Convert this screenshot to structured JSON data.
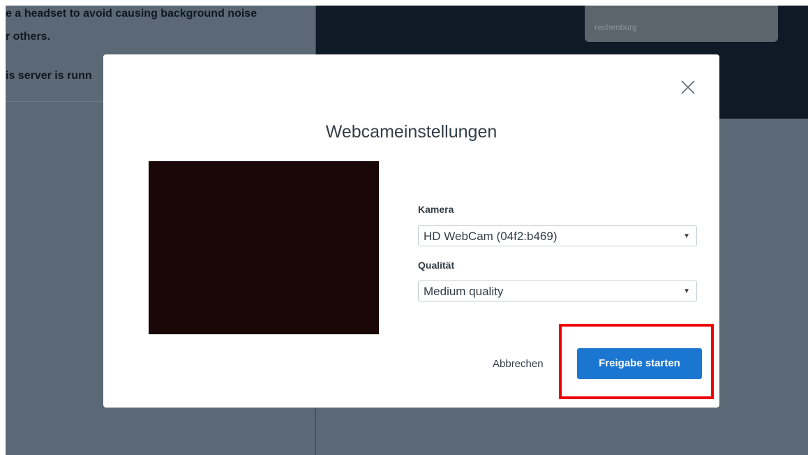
{
  "background": {
    "chat_lines": [
      "e a headset to avoid causing background noise",
      "r others.",
      "is server is runn"
    ],
    "video_tile_name": "rechenburg"
  },
  "modal": {
    "title": "Webcameinstellungen",
    "close_icon": "close-icon",
    "camera_label": "Kamera",
    "camera_value": "HD WebCam (04f2:b469)",
    "quality_label": "Qualität",
    "quality_value": "Medium quality",
    "dropdown_arrow": "▼",
    "cancel_label": "Abbrechen",
    "start_label": "Freigabe starten"
  },
  "colors": {
    "primary": "#1b76d1",
    "highlight": "#ee0000",
    "overlay": "#5b6976",
    "dark_panel": "#0f1a27"
  }
}
